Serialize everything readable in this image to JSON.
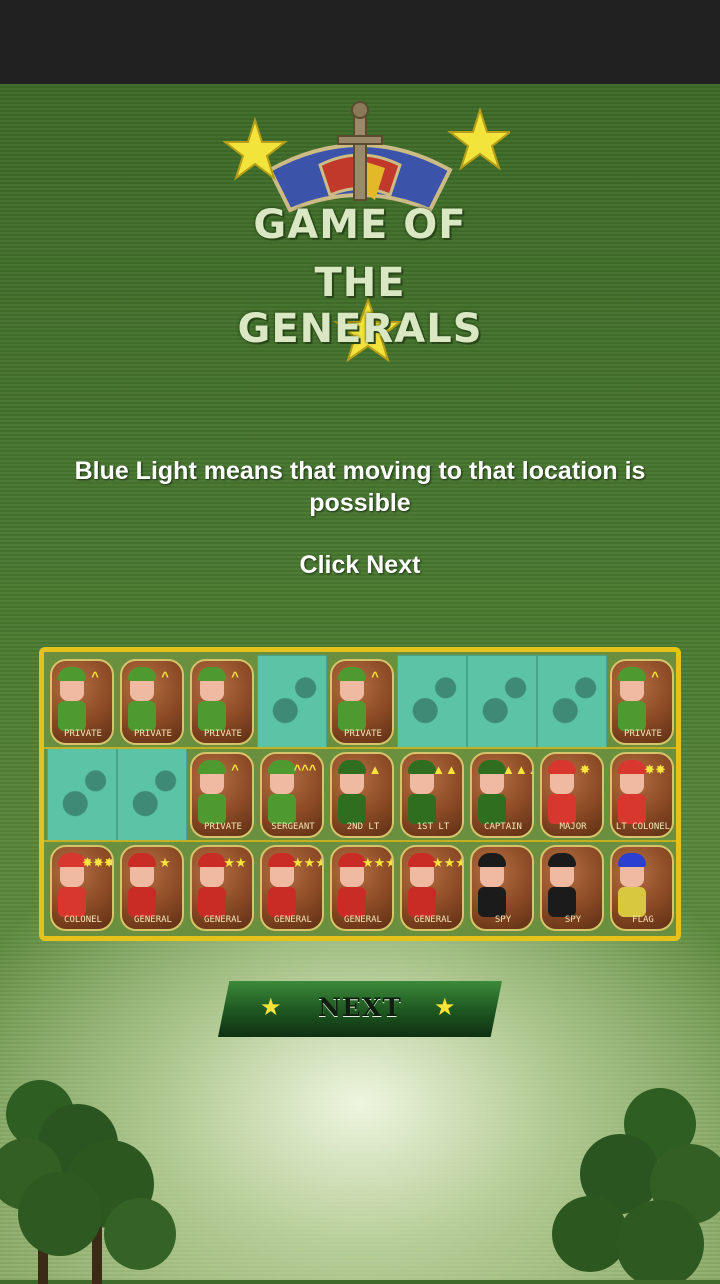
{
  "logo": {
    "line1": "GAME OF",
    "line2": "THE GENERALS"
  },
  "message": "Blue Light means that moving to that location is possible",
  "instruction": "Click Next",
  "next_button": {
    "label": "NEXT"
  },
  "colors": {
    "board_border": "#e5c21a",
    "empty_tile": "#5bc4a6",
    "piece_wood": "#8b4a25",
    "accent_star": "#f8e33a"
  },
  "board": {
    "rows": [
      [
        {
          "type": "piece",
          "name": "private",
          "label": "PRIVATE",
          "insignia": "^",
          "helmet": "#4f9a2f"
        },
        {
          "type": "piece",
          "name": "private",
          "label": "PRIVATE",
          "insignia": "^",
          "helmet": "#4f9a2f"
        },
        {
          "type": "piece",
          "name": "private",
          "label": "PRIVATE",
          "insignia": "^",
          "helmet": "#4f9a2f"
        },
        {
          "type": "empty"
        },
        {
          "type": "piece",
          "name": "private",
          "label": "PRIVATE",
          "insignia": "^",
          "helmet": "#4f9a2f"
        },
        {
          "type": "empty"
        },
        {
          "type": "empty"
        },
        {
          "type": "empty"
        },
        {
          "type": "piece",
          "name": "private",
          "label": "PRIVATE",
          "insignia": "^",
          "helmet": "#4f9a2f"
        }
      ],
      [
        {
          "type": "empty"
        },
        {
          "type": "empty"
        },
        {
          "type": "piece",
          "name": "private",
          "label": "PRIVATE",
          "insignia": "^",
          "helmet": "#4f9a2f"
        },
        {
          "type": "piece",
          "name": "sergeant",
          "label": "SERGEANT",
          "insignia": "^^^",
          "helmet": "#4f9a2f"
        },
        {
          "type": "piece",
          "name": "lieutenant",
          "label": "2ND LT",
          "insignia": "▲",
          "helmet": "#2f6e1e"
        },
        {
          "type": "piece",
          "name": "lieutenant",
          "label": "1ST LT",
          "insignia": "▲▲",
          "helmet": "#2f6e1e"
        },
        {
          "type": "piece",
          "name": "captain",
          "label": "CAPTAIN",
          "insignia": "▲▲▲",
          "helmet": "#2f6e1e"
        },
        {
          "type": "piece",
          "name": "major",
          "label": "MAJOR",
          "insignia": "✸",
          "helmet": "#d7372c"
        },
        {
          "type": "piece",
          "name": "lt-colonel",
          "label": "LT COLONEL",
          "insignia": "✸✸",
          "helmet": "#d7372c"
        }
      ],
      [
        {
          "type": "piece",
          "name": "colonel",
          "label": "COLONEL",
          "insignia": "✸✸✸",
          "helmet": "#d7372c"
        },
        {
          "type": "piece",
          "name": "general",
          "label": "GENERAL",
          "insignia": "★",
          "helmet": "#c92b25"
        },
        {
          "type": "piece",
          "name": "general",
          "label": "GENERAL",
          "insignia": "★★",
          "helmet": "#c92b25"
        },
        {
          "type": "piece",
          "name": "general",
          "label": "GENERAL",
          "insignia": "★★★",
          "helmet": "#c92b25"
        },
        {
          "type": "piece",
          "name": "general",
          "label": "GENERAL",
          "insignia": "★★★★",
          "helmet": "#c92b25"
        },
        {
          "type": "piece",
          "name": "general",
          "label": "GENERAL",
          "insignia": "★★★★★",
          "helmet": "#c92b25"
        },
        {
          "type": "piece",
          "name": "spy",
          "label": "SPY",
          "insignia": "",
          "helmet": "#1b1b1b"
        },
        {
          "type": "piece",
          "name": "spy",
          "label": "SPY",
          "insignia": "",
          "helmet": "#1b1b1b"
        },
        {
          "type": "piece",
          "name": "flag",
          "label": "FLAG",
          "insignia": "",
          "helmet": "#2b3fd0"
        }
      ]
    ]
  }
}
